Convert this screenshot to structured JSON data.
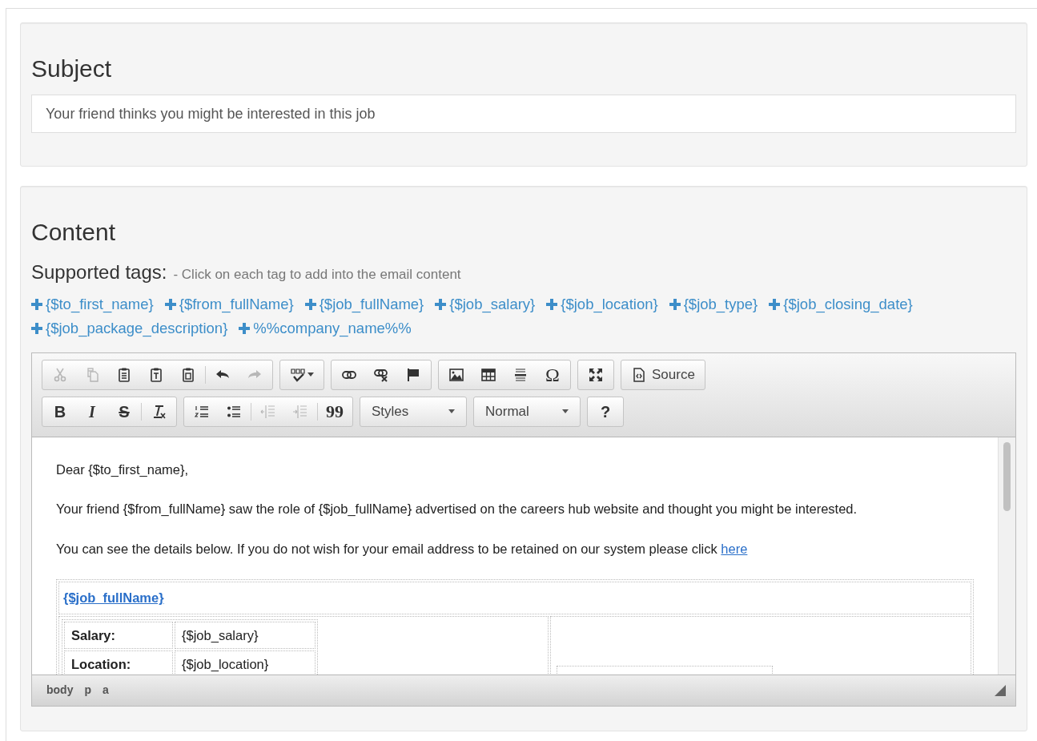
{
  "subject": {
    "heading": "Subject",
    "value": "Your friend thinks you might be interested in this job"
  },
  "content": {
    "heading": "Content",
    "tags_label": "Supported tags:",
    "tags_hint": "- Click on each tag to add into the email content",
    "tags": [
      "{$to_first_name}",
      "{$from_fullName}",
      "{$job_fullName}",
      "{$job_salary}",
      "{$job_location}",
      "{$job_type}",
      "{$job_closing_date}",
      "{$job_package_description}",
      "%%company_name%%"
    ],
    "editor": {
      "toolbar_rows": [
        [
          {
            "buttons": [
              {
                "kind": "icon",
                "disabled": true
              },
              {
                "kind": "icon",
                "disabled": true
              },
              {
                "kind": "icon",
                "disabled": false
              },
              {
                "kind": "icon",
                "disabled": false
              },
              {
                "kind": "icon",
                "disabled": false
              },
              {
                "kind": "separator"
              },
              {
                "kind": "icon",
                "disabled": false
              },
              {
                "kind": "icon",
                "disabled": true
              }
            ]
          },
          {
            "buttons": [
              {
                "kind": "icon-dropdown",
                "disabled": false
              }
            ]
          },
          {
            "buttons": [
              {
                "kind": "icon",
                "disabled": false
              },
              {
                "kind": "icon",
                "disabled": false
              },
              {
                "kind": "icon",
                "disabled": false
              }
            ]
          },
          {
            "buttons": [
              {
                "kind": "icon",
                "disabled": false
              },
              {
                "kind": "icon",
                "disabled": false
              },
              {
                "kind": "icon",
                "disabled": false
              },
              {
                "kind": "glyph",
                "glyph": "Ω",
                "disabled": false
              }
            ]
          },
          {
            "buttons": [
              {
                "kind": "icon",
                "disabled": false
              }
            ]
          },
          {
            "buttons": [
              {
                "kind": "icon-label",
                "label": "Source",
                "disabled": false
              }
            ]
          }
        ],
        [
          {
            "buttons": [
              {
                "kind": "glyph",
                "glyph": "B",
                "disabled": false
              },
              {
                "kind": "glyph",
                "glyph": "I",
                "disabled": false
              },
              {
                "kind": "glyph",
                "glyph": "S",
                "disabled": false
              },
              {
                "kind": "separator"
              },
              {
                "kind": "icon",
                "disabled": false
              }
            ]
          },
          {
            "buttons": [
              {
                "kind": "icon",
                "disabled": false
              },
              {
                "kind": "icon",
                "disabled": false
              },
              {
                "kind": "separator"
              },
              {
                "kind": "icon",
                "disabled": true
              },
              {
                "kind": "icon",
                "disabled": true
              },
              {
                "kind": "separator"
              },
              {
                "kind": "glyph",
                "glyph": "99",
                "disabled": false
              }
            ]
          },
          {
            "buttons": [
              {
                "kind": "combo",
                "label": "Styles"
              }
            ]
          },
          {
            "buttons": [
              {
                "kind": "combo",
                "label": "Normal"
              }
            ]
          },
          {
            "buttons": [
              {
                "kind": "glyph",
                "glyph": "?",
                "disabled": false
              }
            ]
          }
        ]
      ],
      "paragraphs": [
        {
          "text": "Dear {$to_first_name},"
        },
        {
          "text": "Your friend {$from_fullName} saw the role of {$job_fullName} advertised on the careers hub website and thought you might be interested."
        },
        {
          "text": "You can see the details below. If you do not wish for your email address to be retained on our system please click ",
          "link": "here"
        }
      ],
      "job_table": {
        "title": "{$job_fullName}",
        "rows": [
          {
            "label": "Salary:",
            "value": "{$job_salary}"
          },
          {
            "label": "Location:",
            "value": "{$job_location}"
          }
        ]
      },
      "path": [
        "body",
        "p",
        "a"
      ]
    }
  }
}
